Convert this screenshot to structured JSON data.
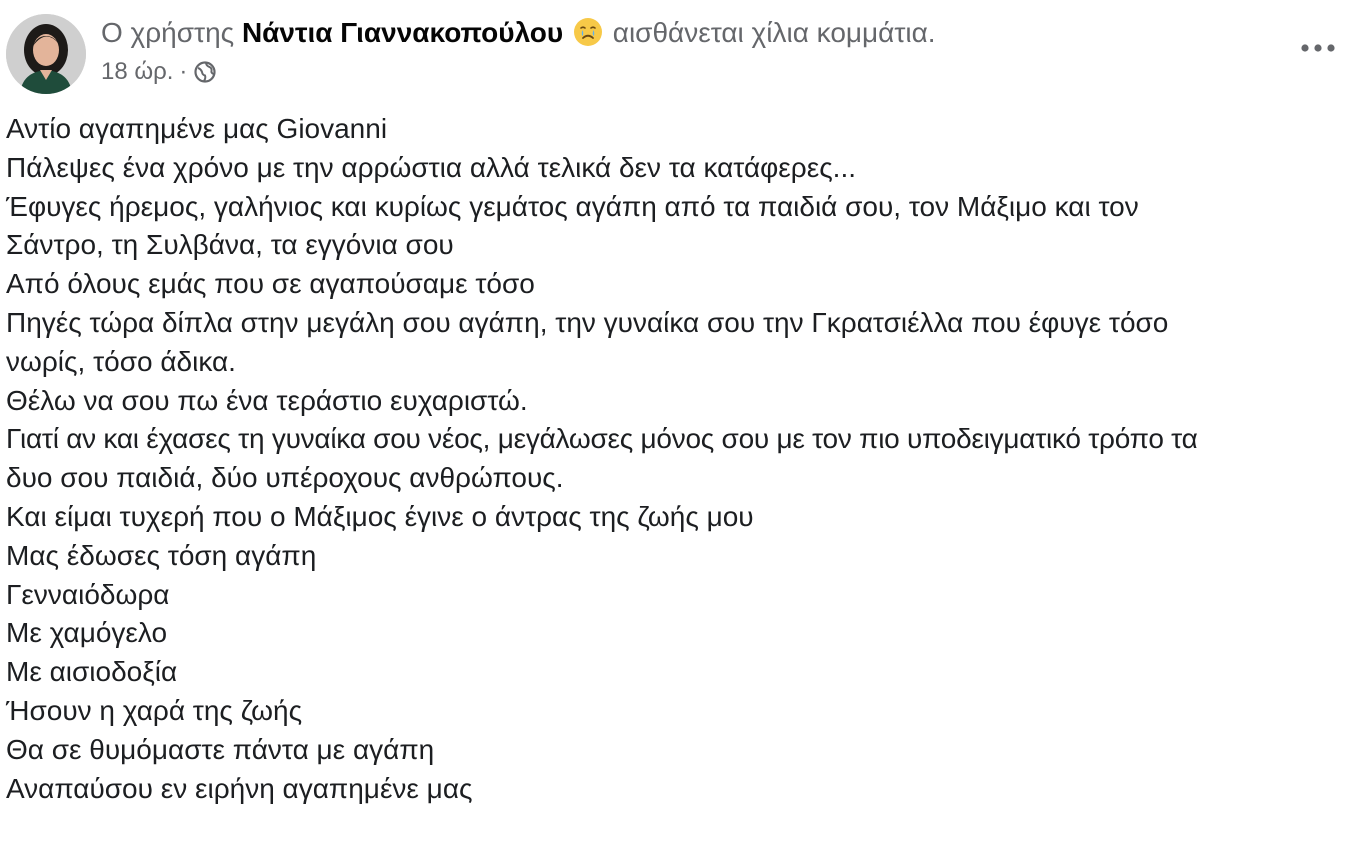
{
  "header": {
    "prefix": "Ο χρήστης",
    "author_name": "Νάντια Γιαννακοπούλου",
    "feeling_icon": "sad-crying-face-icon",
    "feeling_text": "αισθάνεται χίλια κομμάτια."
  },
  "meta": {
    "time": "18 ώρ.",
    "separator": "·",
    "audience_icon": "globe-icon"
  },
  "more_icon": "more-horizontal-icon",
  "body": {
    "lines": [
      "Αντίο αγαπημένε μας Giovanni",
      "Πάλεψες ένα χρόνο με την αρρώστια αλλά τελικά δεν τα κατάφερες...",
      "Έφυγες ήρεμος, γαλήνιος και κυρίως γεμάτος αγάπη από τα παιδιά σου, τον Μάξιμο και τον",
      "Σάντρο, τη Συλβάνα, τα εγγόνια σου",
      "Από όλους εμάς που σε αγαπούσαμε τόσο",
      "Πηγές τώρα δίπλα στην μεγάλη σου αγάπη, την γυναίκα σου την Γκρατσιέλλα που έφυγε τόσο",
      "νωρίς, τόσο άδικα.",
      "Θέλω να σου πω ένα τεράστιο ευχαριστώ.",
      "Γιατί αν και έχασες τη γυναίκα σου νέος, μεγάλωσες μόνος σου με τον πιο υποδειγματικό τρόπο τα",
      "δυο σου παιδιά, δύο υπέροχους ανθρώπους.",
      "Και είμαι τυχερή που ο Μάξιμος έγινε ο άντρας της ζωής μου",
      "Μας έδωσες τόση αγάπη",
      "Γενναιόδωρα",
      "Με χαμόγελο",
      "Με αισιοδοξία",
      "Ήσουν η χαρά της ζωής",
      "Θα σε θυμόμαστε πάντα με αγάπη",
      "Αναπαύσου εν ειρήνη αγαπημένε μας"
    ]
  },
  "colors": {
    "secondary_text": "#65676b",
    "primary_text": "#050505",
    "emoji_yellow": "#f7c948"
  }
}
